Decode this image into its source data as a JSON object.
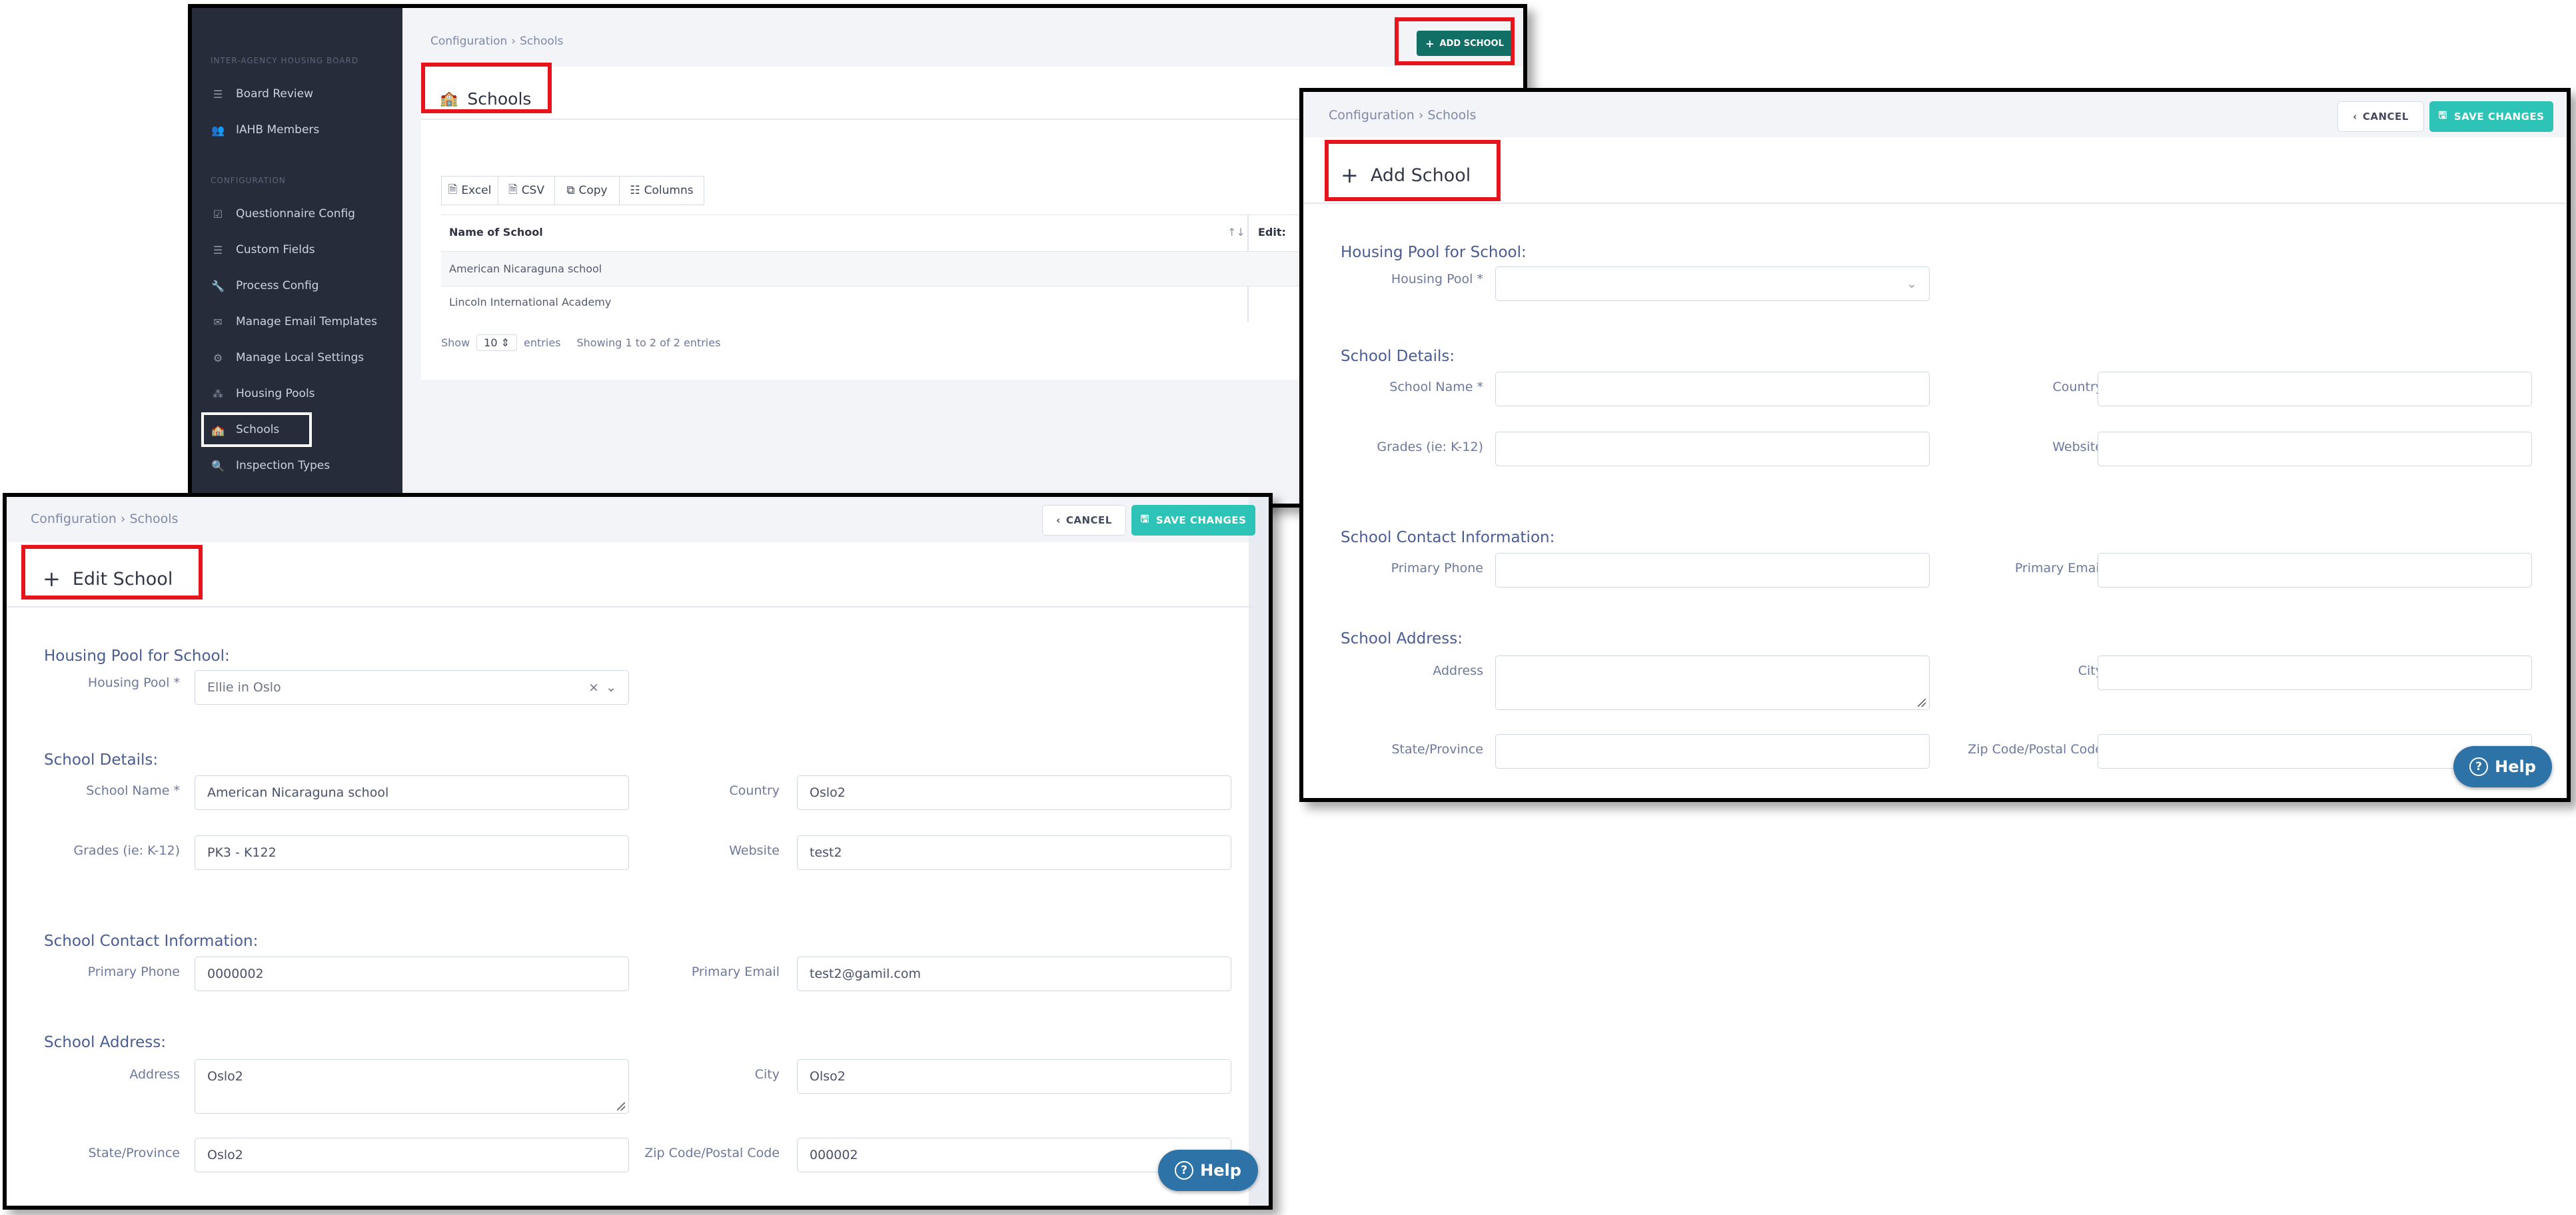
{
  "schools_list": {
    "breadcrumb": [
      "Configuration",
      "Schools"
    ],
    "add_button": "ADD SCHOOL",
    "title": "Schools",
    "sidebar": {
      "section1": "INTER-AGENCY HOUSING BOARD",
      "items1": [
        {
          "label": "Board Review",
          "icon": "list-icon"
        },
        {
          "label": "IAHB Members",
          "icon": "users-icon"
        }
      ],
      "section2": "CONFIGURATION",
      "items2": [
        {
          "label": "Questionnaire Config",
          "icon": "checkbox-icon"
        },
        {
          "label": "Custom Fields",
          "icon": "list-icon"
        },
        {
          "label": "Process Config",
          "icon": "wrench-icon"
        },
        {
          "label": "Manage Email Templates",
          "icon": "envelope-icon"
        },
        {
          "label": "Manage Local Settings",
          "icon": "gear-icon"
        },
        {
          "label": "Housing Pools",
          "icon": "sitemap-icon"
        },
        {
          "label": "Schools",
          "icon": "school-icon"
        },
        {
          "label": "Inspection Types",
          "icon": "search-icon"
        }
      ]
    },
    "toolbar": [
      "Excel",
      "CSV",
      "Copy",
      "Columns"
    ],
    "columns": [
      "Name of School",
      "Edit:"
    ],
    "rows": [
      "American Nicaraguna school",
      "Lincoln International Academy"
    ],
    "show_label": "Show",
    "page_size": "10",
    "entries_label": "entries",
    "info": "Showing 1 to 2 of 2 entries"
  },
  "add_school": {
    "breadcrumb": [
      "Configuration",
      "Schools"
    ],
    "cancel": "CANCEL",
    "save": "SAVE CHANGES",
    "title": "Add School",
    "sections": {
      "pool": "Housing Pool for School:",
      "details": "School Details:",
      "contact": "School Contact Information:",
      "address": "School Address:"
    },
    "labels": {
      "housing_pool": "Housing Pool *",
      "school_name": "School Name *",
      "country": "Country",
      "grades": "Grades (ie: K-12)",
      "website": "Website",
      "primary_phone": "Primary Phone",
      "primary_email": "Primary Email",
      "address": "Address",
      "city": "City",
      "state": "State/Province",
      "zip": "Zip Code/Postal Code"
    },
    "values": {
      "housing_pool": "",
      "school_name": "",
      "country": "",
      "grades": "",
      "website": "",
      "primary_phone": "",
      "primary_email": "",
      "address": "",
      "city": "",
      "state": "",
      "zip": ""
    },
    "help": "Help"
  },
  "edit_school": {
    "breadcrumb": [
      "Configuration",
      "Schools"
    ],
    "cancel": "CANCEL",
    "save": "SAVE CHANGES",
    "title": "Edit School",
    "sections": {
      "pool": "Housing Pool for School:",
      "details": "School Details:",
      "contact": "School Contact Information:",
      "address": "School Address:"
    },
    "labels": {
      "housing_pool": "Housing Pool *",
      "school_name": "School Name *",
      "country": "Country",
      "grades": "Grades (ie: K-12)",
      "website": "Website",
      "primary_phone": "Primary Phone",
      "primary_email": "Primary Email",
      "address": "Address",
      "city": "City",
      "state": "State/Province",
      "zip": "Zip Code/Postal Code"
    },
    "values": {
      "housing_pool": "Ellie in Oslo",
      "school_name": "American Nicaraguna school",
      "country": "Oslo2",
      "grades": "PK3 - K122",
      "website": "test2",
      "primary_phone": "0000002",
      "primary_email": "test2@gamil.com",
      "address": "Oslo2",
      "city": "Olso2",
      "state": "Oslo2",
      "zip": "000002"
    },
    "help": "Help"
  },
  "colors": {
    "teal_dark": "#126f66",
    "teal": "#2ec3b7",
    "sidebar": "#272c3b",
    "highlight": "#e8141b",
    "help": "#2e73a8"
  }
}
